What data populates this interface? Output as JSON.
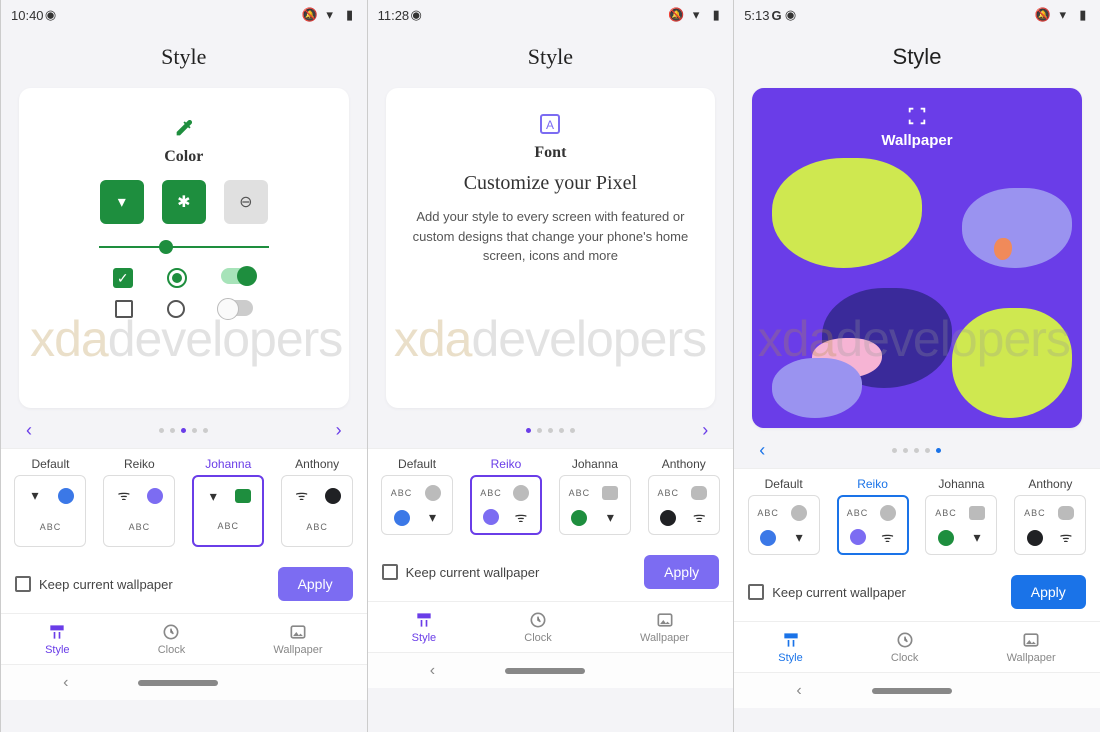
{
  "watermark_a": "xda",
  "watermark_b": "developers",
  "screens": [
    {
      "time": "10:40",
      "title": "Style",
      "card": {
        "type": "color",
        "label": "Color"
      },
      "dot_active": 2,
      "themes": [
        "Default",
        "Reiko",
        "Johanna",
        "Anthony"
      ],
      "theme_selected": 2,
      "keep_wallpaper_label": "Keep current wallpaper",
      "apply_label": "Apply",
      "tabs": [
        "Style",
        "Clock",
        "Wallpaper"
      ],
      "tab_active": 0,
      "accent": "purple"
    },
    {
      "time": "11:28",
      "title": "Style",
      "card": {
        "type": "font",
        "label": "Font",
        "headline": "Customize your Pixel",
        "desc": "Add your style to every screen with featured or custom designs that change your phone's home screen, icons and more"
      },
      "dot_active": 0,
      "themes": [
        "Default",
        "Reiko",
        "Johanna",
        "Anthony"
      ],
      "theme_selected": 1,
      "keep_wallpaper_label": "Keep current wallpaper",
      "apply_label": "Apply",
      "tabs": [
        "Style",
        "Clock",
        "Wallpaper"
      ],
      "tab_active": 0,
      "accent": "purple"
    },
    {
      "time": "5:13",
      "has_g": true,
      "title": "Style",
      "card": {
        "type": "wallpaper",
        "label": "Wallpaper"
      },
      "dot_active": 4,
      "themes": [
        "Default",
        "Reiko",
        "Johanna",
        "Anthony"
      ],
      "theme_selected": 1,
      "keep_wallpaper_label": "Keep current wallpaper",
      "apply_label": "Apply",
      "tabs": [
        "Style",
        "Clock",
        "Wallpaper"
      ],
      "tab_active": 0,
      "accent": "blue"
    }
  ],
  "theme_colors": {
    "Default": "#3b78e7",
    "Reiko": "#7c6cf2",
    "Johanna": "#1e8e3e",
    "Anthony": "#202124"
  },
  "abc_label": "ABC"
}
